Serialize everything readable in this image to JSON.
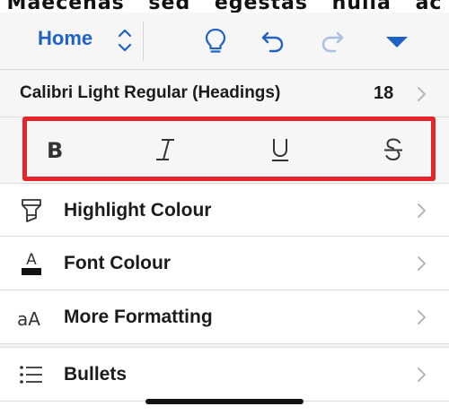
{
  "document": {
    "peek_text": "Maecenas sed egestas nulla ac"
  },
  "toolbar": {
    "tab_label": "Home",
    "icons": [
      "chevron-up-down-icon",
      "lightbulb-icon",
      "undo-icon",
      "redo-icon",
      "caret-down-icon"
    ]
  },
  "font": {
    "name": "Calibri Light Regular (Headings)",
    "size": "18"
  },
  "text_styles": [
    {
      "label": "B",
      "icon": "bold-icon"
    },
    {
      "label": "I",
      "icon": "italic-icon"
    },
    {
      "label": "U",
      "icon": "underline-icon"
    },
    {
      "label": "S",
      "icon": "strikethrough-icon"
    }
  ],
  "menu": {
    "highlight_label": "Highlight Colour",
    "font_colour_label": "Font Colour",
    "font_colour_icon_letter": "A",
    "more_formatting_label": "More Formatting",
    "more_formatting_icon_text": "aA",
    "bullets_label": "Bullets"
  },
  "colors": {
    "accent": "#1f62c4",
    "highlight_box": "#e8242b",
    "toolbar_bg": "#f6f6f7"
  }
}
